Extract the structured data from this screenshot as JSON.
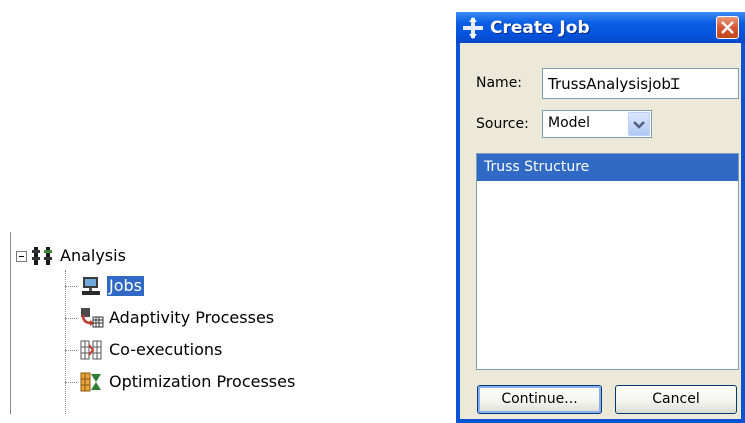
{
  "tree": {
    "items": [
      {
        "label": "Analysis",
        "icon": "analysis-icon"
      },
      {
        "label": "Jobs",
        "icon": "jobs-icon",
        "selected": true
      },
      {
        "label": "Adaptivity Processes",
        "icon": "adaptivity-icon"
      },
      {
        "label": "Co-executions",
        "icon": "co-execution-icon"
      },
      {
        "label": "Optimization Processes",
        "icon": "optimization-icon"
      }
    ]
  },
  "dialog": {
    "title": "Create Job",
    "name_label": "Name:",
    "name_value": "TrussAnalysisjob",
    "source_label": "Source:",
    "source_value": "Model",
    "list_items": [
      "Truss Structure"
    ],
    "continue_label": "Continue...",
    "cancel_label": "Cancel"
  },
  "colors": {
    "selection": "#316ac5",
    "titlebar": "#0554dd",
    "dialog_face": "#ece9d8",
    "close_button": "#d65833"
  }
}
